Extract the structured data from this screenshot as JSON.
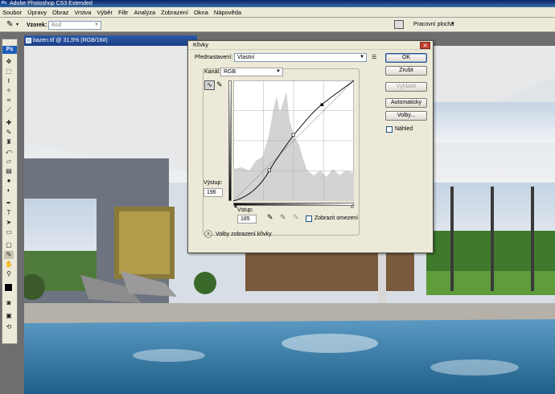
{
  "app": {
    "title": "Adobe Photoshop CS3 Extended",
    "logo": "Ps"
  },
  "menu": [
    "Soubor",
    "Úpravy",
    "Obraz",
    "Vrstva",
    "Výběr",
    "Filtr",
    "Analýza",
    "Zobrazení",
    "Okna",
    "Nápověda"
  ],
  "options_bar": {
    "sample_label": "Vzorek:",
    "sample_value": "Bod",
    "workspace_label": "Pracovní plocha"
  },
  "document": {
    "tab_title": "bazen.tif @ 31,5% (RGB/16#)"
  },
  "dialog": {
    "title": "Křivky",
    "preset_label": "Přednastavení:",
    "preset_value": "Vlastní",
    "channel_label": "Kanál:",
    "channel_value": "RGB",
    "output_label": "Výstup:",
    "output_value": "196",
    "input_label": "Vstup:",
    "input_value": "185",
    "show_clipping_label": "Zobrazit omezení",
    "show_clipping_checked": false,
    "curve_options_label": "Volby zobrazení křivky",
    "buttons": {
      "ok": "OK",
      "cancel": "Zrušit",
      "smooth": "Vyhladit",
      "auto": "Automaticky",
      "options": "Volby..."
    },
    "preview_label": "Náhled",
    "preview_checked": false
  },
  "icons": {
    "close": "close-icon",
    "eyedropper": "eyedropper-icon",
    "curve_point_tool": "curve-point-tool-icon",
    "pencil": "pencil-icon",
    "expand": "expand-icon"
  },
  "colors": {
    "accent": "#1c3f86",
    "close_button": "#c44030",
    "dialog_bg": "#ece9d8"
  }
}
